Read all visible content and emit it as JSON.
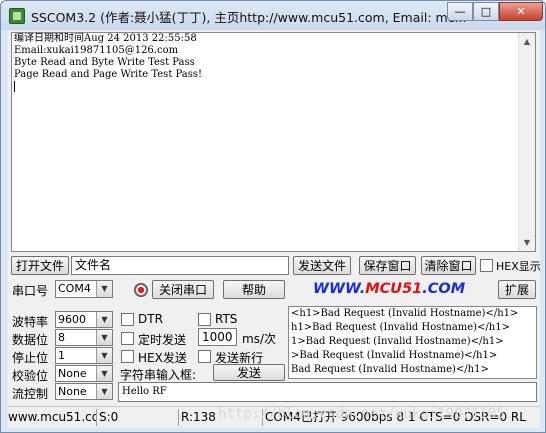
{
  "window": {
    "title": "SSCOM3.2 (作者:聂小猛(丁丁), 主页http://www.mcu51.com,  Email: mc..."
  },
  "titlebar_buttons": {
    "minimize": "—",
    "maximize": "□",
    "close": "✕"
  },
  "log": {
    "lines": [
      "编译日期和时间Aug 24 2013 22:55:58",
      "Email:xukai19871105@126.com",
      "Byte Read and Byte Write Test Pass",
      "Page Read and Page Write Test Pass!"
    ]
  },
  "row1": {
    "open_file": "打开文件",
    "file_name": "文件名",
    "send_file": "发送文件",
    "save_window": "保存窗口",
    "clear_window": "清除窗口",
    "hex_display": "HEX显示"
  },
  "row2": {
    "port_label": "串口号",
    "port_value": "COM4",
    "close_port": "关闭串口",
    "help": "帮助",
    "logo_part1": "WWW.",
    "logo_part2": "MCU51",
    "logo_part3": ".COM",
    "expand": "扩展"
  },
  "settings": {
    "baud_label": "波特率",
    "baud_value": "9600",
    "databits_label": "数据位",
    "databits_value": "8",
    "stopbits_label": "停止位",
    "stopbits_value": "1",
    "parity_label": "校验位",
    "parity_value": "None",
    "flow_label": "流控制",
    "flow_value": "None"
  },
  "options": {
    "dtr": "DTR",
    "rts": "RTS",
    "timed_send": "定时发送",
    "interval_value": "1000",
    "interval_unit": "ms/次",
    "hex_send": "HEX发送",
    "send_newline": "发送新行",
    "string_input_label": "字符串输入框:",
    "send": "发送",
    "input_value": "Hello RF"
  },
  "hex_area": {
    "lines": [
      "<h1>Bad Request (Invalid Hostname)</h1>",
      "h1>Bad Request (Invalid Hostname)</h1>",
      "1>Bad Request (Invalid Hostname)</h1>",
      ">Bad Request (Invalid Hostname)</h1>",
      "Bad Request (Invalid Hostname)</h1>"
    ]
  },
  "status": {
    "website": "www.mcu51.cor",
    "sent": "S:0",
    "received": "R:138",
    "port_status": "COM4已打开  9600bps  8  1  CTS=0 DSR=0 RL",
    "watermark": "http://blog.csdn.net/xukai19871105"
  },
  "colors": {
    "logo_blue": "#1a2bd8",
    "logo_red": "#e01010"
  }
}
